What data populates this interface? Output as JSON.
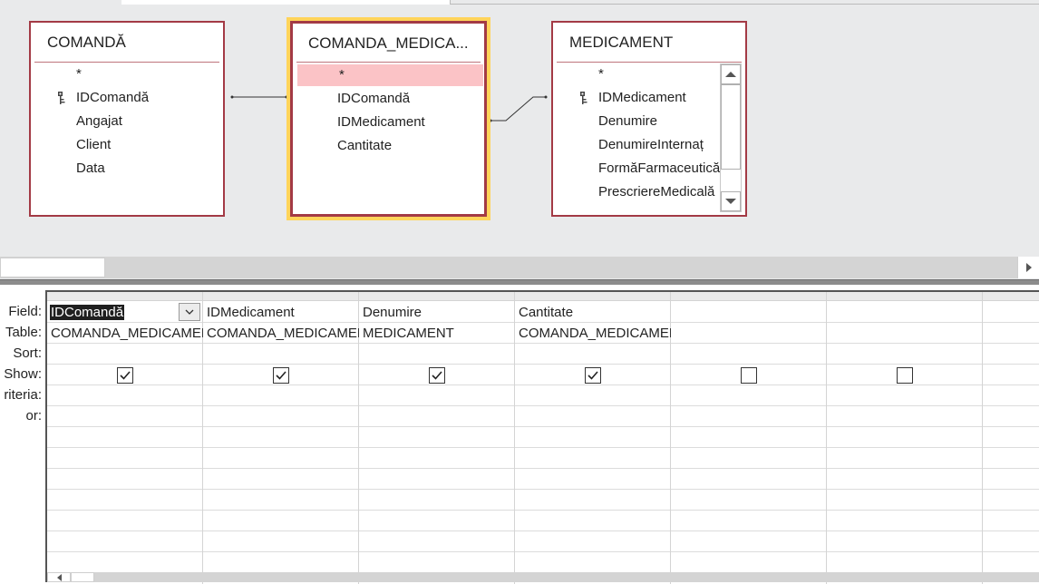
{
  "tables": {
    "comanda": {
      "title": "COMANDĂ",
      "fields": [
        "*",
        "IDComandă",
        "Angajat",
        "Client",
        "Data"
      ]
    },
    "comanda_medicament": {
      "title": "COMANDA_MEDICA...",
      "fields": [
        "*",
        "IDComandă",
        "IDMedicament",
        "Cantitate"
      ]
    },
    "medicament": {
      "title": "MEDICAMENT",
      "fields": [
        "*",
        "IDMedicament",
        "Denumire",
        "DenumireInternaț",
        "FormăFarmaceutică",
        "PrescriereMedicală"
      ]
    }
  },
  "grid": {
    "row_labels": [
      "Field:",
      "Table:",
      "Sort:",
      "Show:",
      "riteria:",
      "or:"
    ],
    "columns": [
      {
        "field": "IDComandă",
        "table": "COMANDA_MEDICAMENT",
        "sort": "",
        "show": true
      },
      {
        "field": "IDMedicament",
        "table": "COMANDA_MEDICAMENT",
        "sort": "",
        "show": true
      },
      {
        "field": "Denumire",
        "table": "MEDICAMENT",
        "sort": "",
        "show": true
      },
      {
        "field": "Cantitate",
        "table": "COMANDA_MEDICAMENT",
        "sort": "",
        "show": true
      },
      {
        "field": "",
        "table": "",
        "sort": "",
        "show": false
      },
      {
        "field": "",
        "table": "",
        "sort": "",
        "show": false
      }
    ]
  },
  "colors": {
    "table_border": "#a33a45",
    "selected_glow": "#ffd45a",
    "field_highlight": "#fbc3c6"
  },
  "icons": [
    "key-icon",
    "scroll-up-icon",
    "scroll-down-icon",
    "scroll-right-icon",
    "scroll-left-icon",
    "dropdown-arrow-icon",
    "checkmark-icon"
  ]
}
